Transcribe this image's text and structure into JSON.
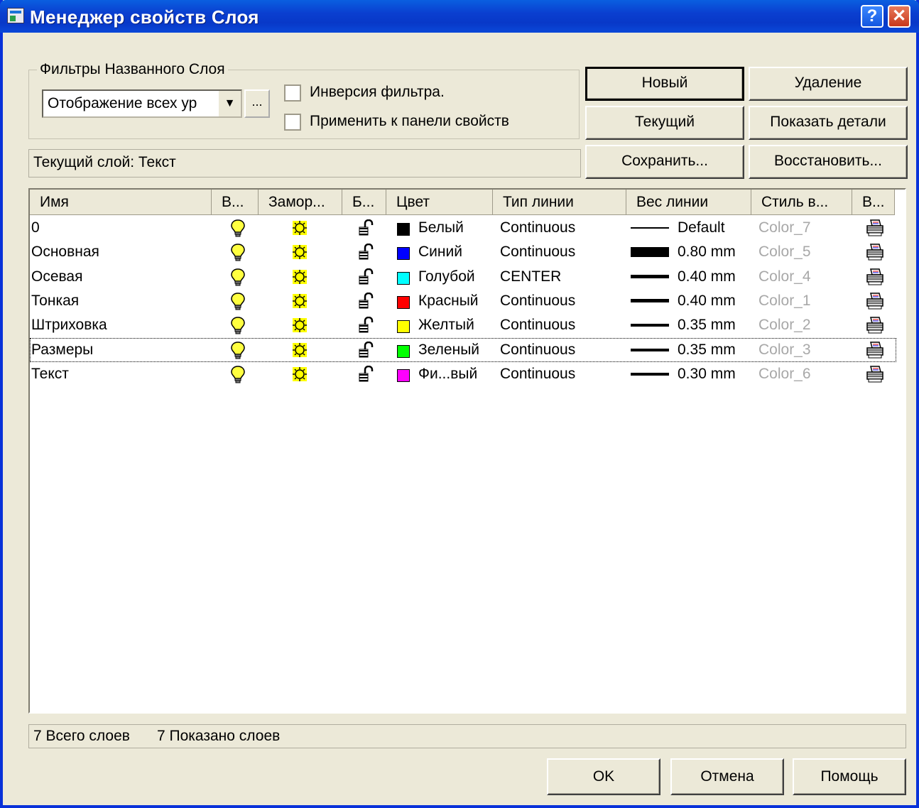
{
  "window": {
    "title": "Менеджер свойств Слоя",
    "help_label": "?",
    "close_label": "✕"
  },
  "filters": {
    "group_label": "Фильтры Названного Слоя",
    "combo_value": "Отображение всех ур",
    "ellipsis_label": "...",
    "invert_label": "Инверсия фильтра.",
    "apply_label": "Применить к панели свойств"
  },
  "buttons": {
    "new": "Новый",
    "delete": "Удаление",
    "current": "Текущий",
    "details": "Показать детали",
    "save": "Сохранить...",
    "restore": "Восстановить..."
  },
  "current_layer": "Текущий слой:  Текст",
  "columns": [
    "Имя",
    "В...",
    "Замор...",
    "Б...",
    "Цвет",
    "Тип линии",
    "Вес линии",
    "Стиль в...",
    "В..."
  ],
  "layers": [
    {
      "name": "0",
      "color_name": "Белый",
      "color": "#000000",
      "linetype": "Continuous",
      "weight": "Default",
      "plot_style": "Color_7"
    },
    {
      "name": "Основная",
      "color_name": "Синий",
      "color": "#0000ff",
      "linetype": "Continuous",
      "weight": "0.80 mm",
      "plot_style": "Color_5"
    },
    {
      "name": "Осевая",
      "color_name": "Голубой",
      "color": "#00ffff",
      "linetype": "CENTER",
      "weight": "0.40 mm",
      "plot_style": "Color_4"
    },
    {
      "name": "Тонкая",
      "color_name": "Красный",
      "color": "#ff0000",
      "linetype": "Continuous",
      "weight": "0.40 mm",
      "plot_style": "Color_1"
    },
    {
      "name": "Штриховка",
      "color_name": "Желтый",
      "color": "#ffff00",
      "linetype": "Continuous",
      "weight": "0.35 mm",
      "plot_style": "Color_2"
    },
    {
      "name": "Размеры",
      "color_name": "Зеленый",
      "color": "#00ff00",
      "linetype": "Continuous",
      "weight": "0.35 mm",
      "plot_style": "Color_3"
    },
    {
      "name": "Текст",
      "color_name": "Фи...вый",
      "color": "#ff00ff",
      "linetype": "Continuous",
      "weight": "0.30 mm",
      "plot_style": "Color_6"
    }
  ],
  "selected_row": 5,
  "icons": {
    "on": "lightbulb-icon",
    "freeze": "sun-icon",
    "lock": "unlocked-padlock-icon",
    "plot": "printer-icon"
  },
  "status": {
    "total": "7 Всего слоев",
    "shown": "7 Показано слоев"
  },
  "footer": {
    "ok": "OK",
    "cancel": "Отмена",
    "help": "Помощь"
  }
}
